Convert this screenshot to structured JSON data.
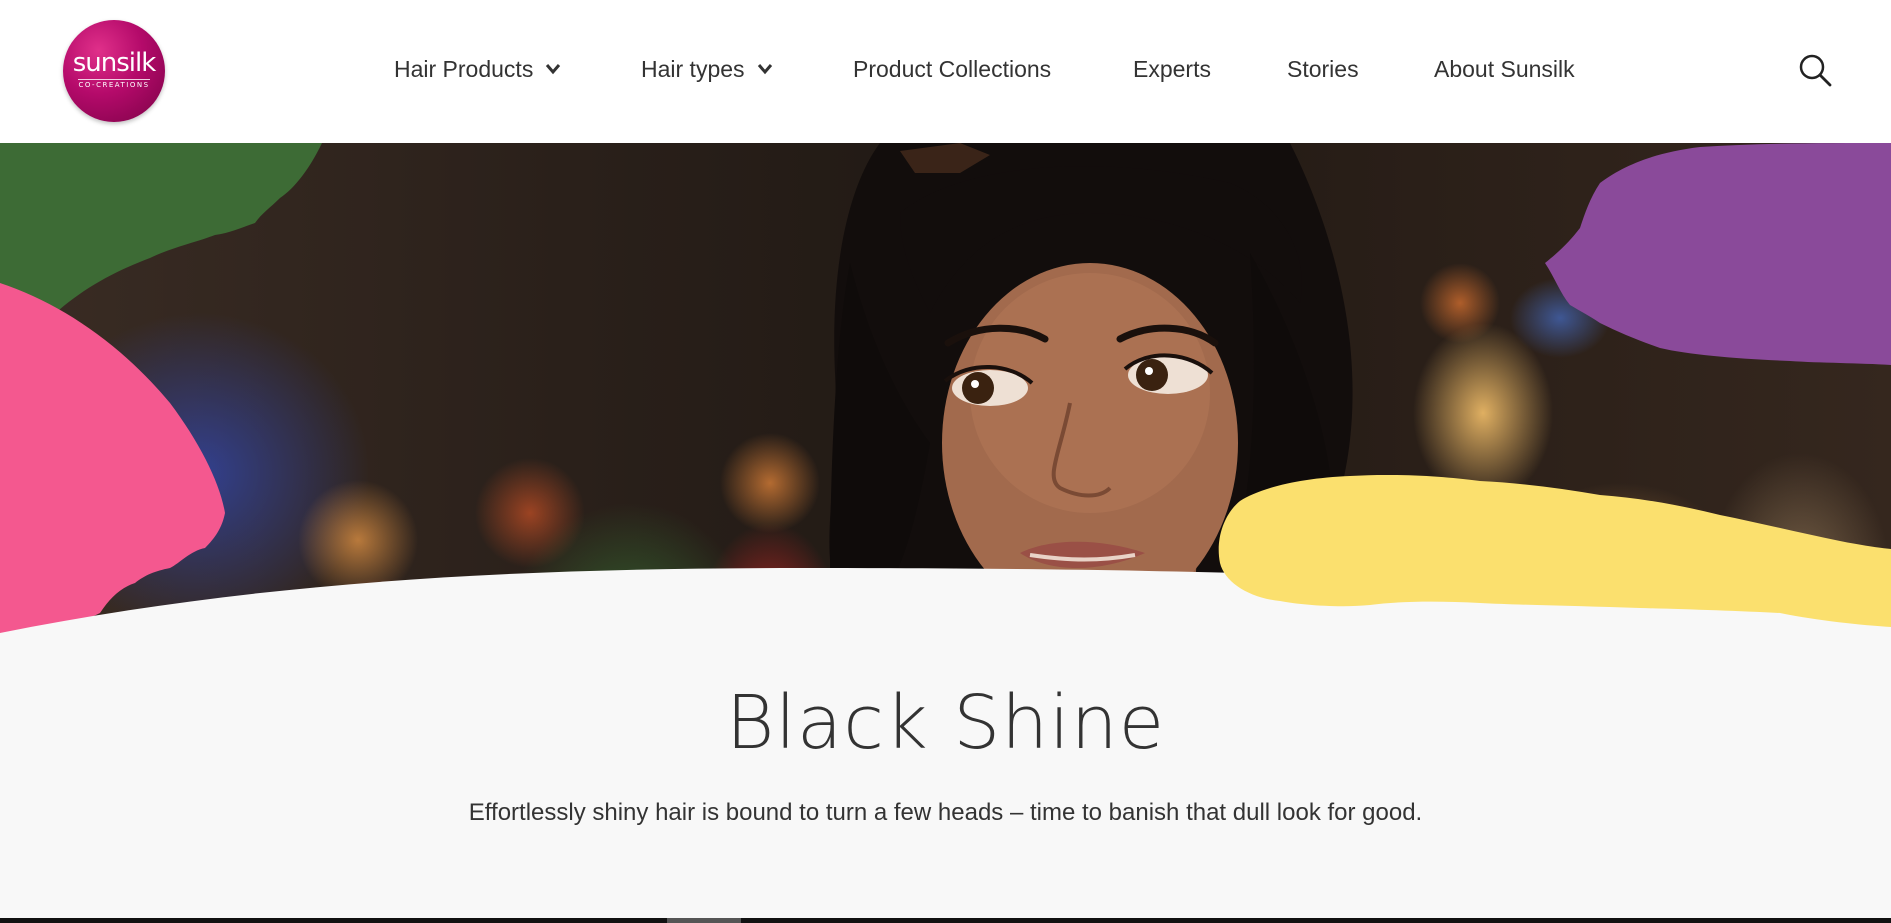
{
  "header": {
    "logo": {
      "word": "sunsilk",
      "sub": "CO-CREATIONS",
      "color": "#b40a6a"
    },
    "nav": [
      {
        "label": "Hair Products",
        "has_dropdown": true
      },
      {
        "label": "Hair types",
        "has_dropdown": true
      },
      {
        "label": "Product Collections",
        "has_dropdown": false
      },
      {
        "label": "Experts",
        "has_dropdown": false
      },
      {
        "label": "Stories",
        "has_dropdown": false
      },
      {
        "label": "About Sunsilk",
        "has_dropdown": false
      }
    ],
    "search_icon": "search-icon"
  },
  "hero": {
    "image": "woman-with-black-hair-portrait",
    "brush_colors": {
      "green": "#3d6b35",
      "pink": "#f4588f",
      "purple": "#8a4a9a",
      "yellow": "#fbe06e"
    }
  },
  "main": {
    "title": "Black Shine",
    "subtitle": "Effortlessly shiny hair is bound to turn a few heads – time to banish that dull look for good."
  }
}
